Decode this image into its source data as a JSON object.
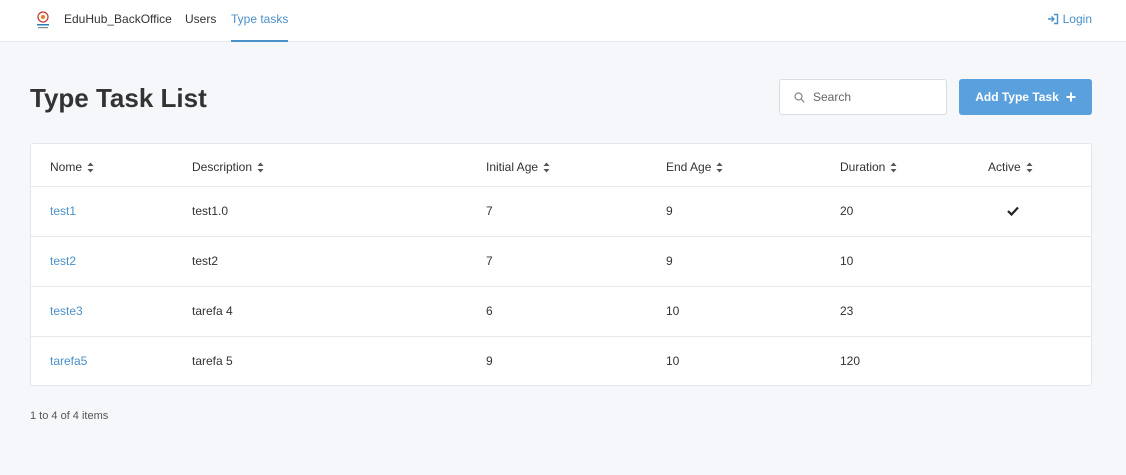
{
  "nav": {
    "brand": "EduHub_BackOffice",
    "links": [
      {
        "label": "Users",
        "active": false
      },
      {
        "label": "Type tasks",
        "active": true
      }
    ],
    "login_label": "Login",
    "accent_color": "#4a90c8"
  },
  "page": {
    "title": "Type Task List"
  },
  "search": {
    "placeholder": "Search",
    "value": ""
  },
  "add_button": {
    "label": "Add Type Task",
    "color": "#5aa0dd",
    "icon": "plus-icon"
  },
  "table": {
    "columns": [
      "Nome",
      "Description",
      "Initial Age",
      "End Age",
      "Duration",
      "Active"
    ],
    "rows": [
      {
        "nome": "test1",
        "description": "test1.0",
        "initial_age": "7",
        "end_age": "9",
        "duration": "20",
        "active": true
      },
      {
        "nome": "test2",
        "description": "test2",
        "initial_age": "7",
        "end_age": "9",
        "duration": "10",
        "active": false
      },
      {
        "nome": "teste3",
        "description": "tarefa 4",
        "initial_age": "6",
        "end_age": "10",
        "duration": "23",
        "active": false
      },
      {
        "nome": "tarefa5",
        "description": "tarefa 5",
        "initial_age": "9",
        "end_age": "10",
        "duration": "120",
        "active": false
      }
    ]
  },
  "pager": {
    "info": "1 to 4 of 4 items"
  }
}
